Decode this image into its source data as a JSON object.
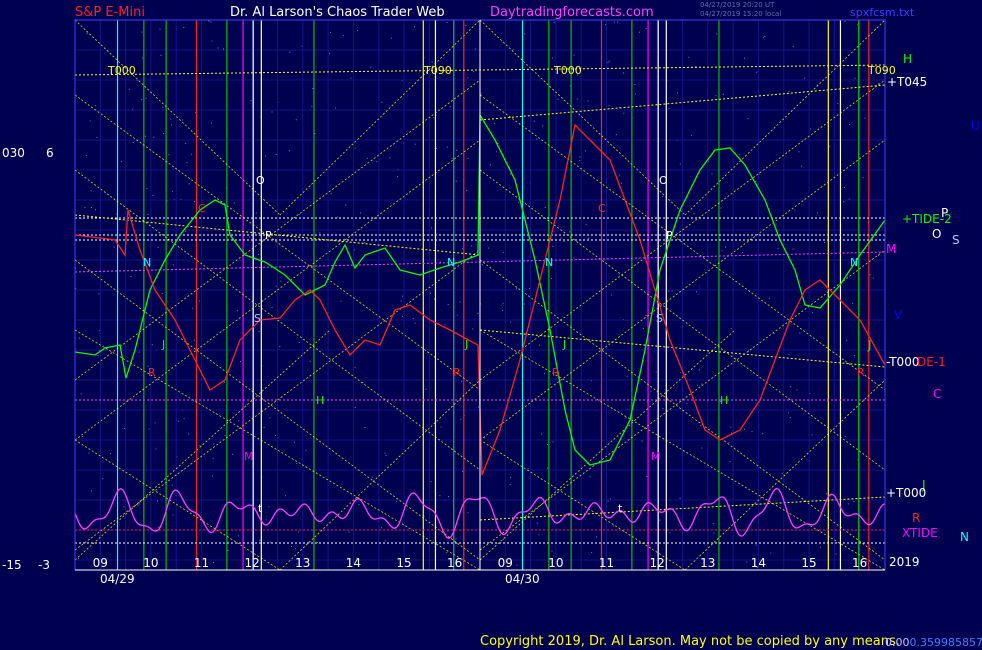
{
  "header": {
    "instrument": "S&P E-Mini",
    "site_title": "Dr. Al Larson's Chaos Trader Web",
    "url": "Daytradingforecasts.com",
    "stamp_line1": "04/27/2019 20:20 UT",
    "stamp_line2": "04/27/2019 15:20 local",
    "file": "spxfcsm.txt"
  },
  "left_axis": {
    "top_label_a": "030",
    "top_label_b": "6",
    "bottom_label_a": "-15",
    "bottom_label_b": "-3"
  },
  "chart_data": {
    "type": "line",
    "time_labels": [
      "09",
      "10",
      "11",
      "12",
      "13",
      "14",
      "15",
      "16",
      "09",
      "10",
      "11",
      "12",
      "13",
      "14",
      "15",
      "16"
    ],
    "date_labels": [
      "04/29",
      "04/30"
    ],
    "year_label": "2019",
    "series": [
      {
        "color": "#00ff00"
      },
      {
        "color": "#ff2020"
      },
      {
        "color": "#ff40ff"
      }
    ],
    "right_labels": [
      {
        "text": "H",
        "color": "#00ff00"
      },
      {
        "text": "+T045",
        "color": "#ffffff"
      },
      {
        "text": "U",
        "color": "#0000ff"
      },
      {
        "text": "P",
        "color": "#ffffff"
      },
      {
        "text": "+TIDE-2",
        "color": "#00ff00"
      },
      {
        "text": "O",
        "color": "#ffffff"
      },
      {
        "text": "S",
        "color": "#c0c0ff"
      },
      {
        "text": "M",
        "color": "#ff00ff"
      },
      {
        "text": "V",
        "color": "#0000ff"
      },
      {
        "text": "J",
        "color": "#00ff00"
      },
      {
        "text": "-T000",
        "color": "#ffffff"
      },
      {
        "text": "DE-1",
        "color": "#ff2020"
      },
      {
        "text": "C",
        "color": "#ff00ff"
      },
      {
        "text": "J",
        "color": "#00ff00"
      },
      {
        "text": "+T000",
        "color": "#ffffff"
      },
      {
        "text": "R",
        "color": "#ff2020"
      },
      {
        "text": "XTIDE",
        "color": "#ff00ff"
      },
      {
        "text": "N",
        "color": "#00ffff"
      }
    ],
    "chart_labels": [
      {
        "text": "T000",
        "color": "#ffff00"
      },
      {
        "text": "T090",
        "color": "#ffff00"
      },
      {
        "text": "T000",
        "color": "#ffff00"
      },
      {
        "text": "T090",
        "color": "#ffff00"
      },
      {
        "text": "O",
        "color": "#ffffff"
      },
      {
        "text": "O",
        "color": "#ffffff"
      },
      {
        "text": "C",
        "color": "#ff2020"
      },
      {
        "text": "C",
        "color": "#ff2020"
      },
      {
        "text": "P",
        "color": "#ffffff"
      },
      {
        "text": "P",
        "color": "#ffffff"
      },
      {
        "text": "N",
        "color": "#00ffff"
      },
      {
        "text": "N",
        "color": "#00ffff"
      },
      {
        "text": "N",
        "color": "#00ffff"
      },
      {
        "text": "N",
        "color": "#00ffff"
      },
      {
        "text": "S",
        "color": "#c0c0ff"
      },
      {
        "text": "S",
        "color": "#c0c0ff"
      },
      {
        "text": "J",
        "color": "#00ff00"
      },
      {
        "text": "J",
        "color": "#00ff00"
      },
      {
        "text": "J",
        "color": "#00ff00"
      },
      {
        "text": "J",
        "color": "#0000ff"
      },
      {
        "text": "R",
        "color": "#ff2020"
      },
      {
        "text": "R",
        "color": "#ff2020"
      },
      {
        "text": "R",
        "color": "#ff2020"
      },
      {
        "text": "R",
        "color": "#ff2020"
      },
      {
        "text": "H",
        "color": "#00ff00"
      },
      {
        "text": "H",
        "color": "#00ff00"
      },
      {
        "text": "M",
        "color": "#ff00ff"
      },
      {
        "text": "M",
        "color": "#ff00ff"
      },
      {
        "text": "t",
        "color": "#ffffff"
      },
      {
        "text": "t",
        "color": "#ffffff"
      }
    ]
  },
  "footer": {
    "copyright": "Copyright 2019, Dr. Al Larson. May not be copied by any means.",
    "tail_a": "0.00",
    "tail_b": "0.3599858578"
  }
}
